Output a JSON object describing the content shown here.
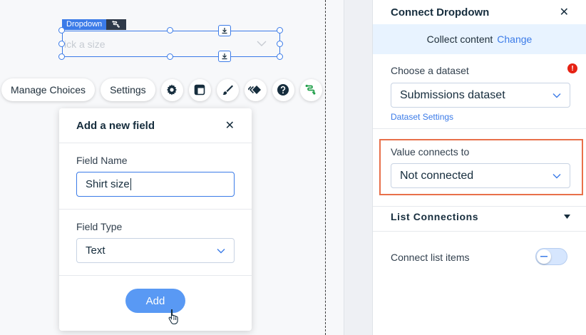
{
  "canvas": {
    "element_tag": "Dropdown",
    "dropdown_placeholder": "ick a size"
  },
  "toolbar": {
    "manage_choices": "Manage Choices",
    "settings": "Settings",
    "icons": [
      "gear-icon",
      "layout-icon",
      "brush-icon",
      "animation-icon",
      "help-icon",
      "connect-data-icon"
    ]
  },
  "add_field": {
    "title": "Add a new field",
    "field_name_label": "Field Name",
    "field_name_value": "Shirt size",
    "field_type_label": "Field Type",
    "field_type_value": "Text",
    "add_button": "Add"
  },
  "panel": {
    "title": "Connect Dropdown",
    "banner_text": "Collect content",
    "banner_link": "Change",
    "dataset_label": "Choose a dataset",
    "dataset_value": "Submissions dataset",
    "dataset_settings": "Dataset Settings",
    "value_label": "Value connects to",
    "value_value": "Not connected",
    "list_connections": "List Connections",
    "connect_list_items": "Connect list items",
    "warning": "!"
  },
  "colors": {
    "accent": "#3b7be8",
    "highlight": "#e8704a",
    "add_button": "#5999f4",
    "banner_bg": "#e8f3ff",
    "warning": "#e62214"
  }
}
